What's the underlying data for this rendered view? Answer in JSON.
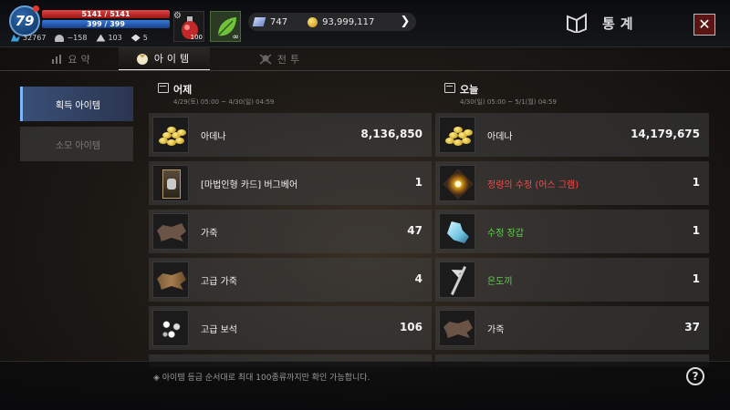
{
  "hud": {
    "level": "79",
    "hp": "5141 / 5141",
    "mp": "399 / 399",
    "stats": [
      "32767",
      "−158",
      "103",
      "5"
    ],
    "potion_count": "100",
    "herb_count": "∞",
    "crystal": "747",
    "gold": "93,999,117",
    "colors": {
      "hp": "#d33a3a",
      "mp": "#2f6bd0",
      "accent": "#7fb5ff"
    }
  },
  "header": {
    "title": "통계",
    "close_icon": "close-icon"
  },
  "tabs": [
    {
      "label": "요약",
      "icon": "chart-icon",
      "active": false
    },
    {
      "label": "아이템",
      "icon": "bag-icon",
      "active": true
    },
    {
      "label": "전투",
      "icon": "skull-icon",
      "active": false
    }
  ],
  "side": [
    {
      "label": "획득 아이템",
      "active": true
    },
    {
      "label": "소모 아이템",
      "active": false
    }
  ],
  "yesterday": {
    "title": "어제",
    "range": "4/29(토) 05:00 ~ 4/30(일) 04:59",
    "items": [
      {
        "name": "아데나",
        "count": "8,136,850",
        "icon": "gold-pile-icon"
      },
      {
        "name": "[마법인형 카드] 버그베어",
        "count": "1",
        "icon": "card-icon"
      },
      {
        "name": "가죽",
        "count": "47",
        "icon": "leather-icon"
      },
      {
        "name": "고급 가죽",
        "count": "4",
        "icon": "fine-leather-icon"
      },
      {
        "name": "고급 보석",
        "count": "106",
        "icon": "gem-icon"
      }
    ]
  },
  "today": {
    "title": "오늘",
    "range": "4/30(일) 05:00 ~ 5/1(월) 04:59",
    "items": [
      {
        "name": "아데나",
        "count": "14,179,675",
        "icon": "gold-pile-icon",
        "color": "#f1f1f1"
      },
      {
        "name": "정령의 수정 (어스 그램)",
        "count": "1",
        "icon": "crystal-icon",
        "color": "#ff4646"
      },
      {
        "name": "수정 장갑",
        "count": "1",
        "icon": "glove-icon",
        "color": "#5fd44d"
      },
      {
        "name": "은도끼",
        "count": "1",
        "icon": "axe-icon",
        "color": "#5fd44d"
      },
      {
        "name": "가죽",
        "count": "37",
        "icon": "leather-icon",
        "color": "#f1f1f1"
      }
    ]
  },
  "footer": {
    "note": "◈ 아이템 등급 순서대로 최대 100종류까지만 확인 가능합니다.",
    "help": "?"
  }
}
